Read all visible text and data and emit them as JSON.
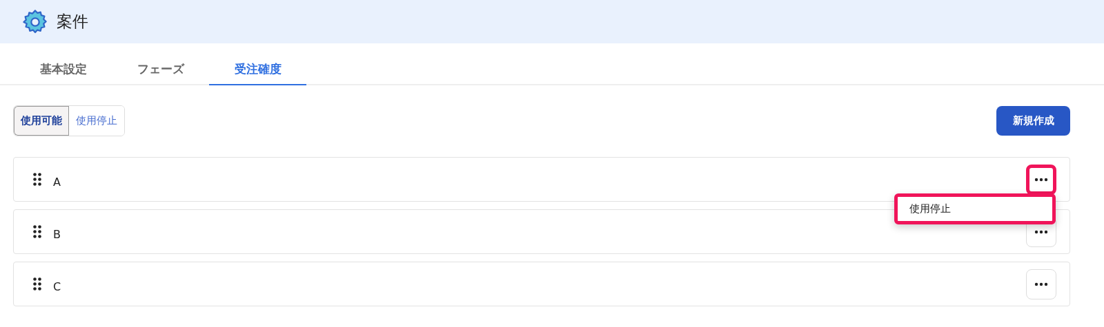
{
  "header": {
    "title": "案件"
  },
  "tabs": [
    {
      "label": "基本設定",
      "selected": false
    },
    {
      "label": "フェーズ",
      "selected": false
    },
    {
      "label": "受注確度",
      "selected": true
    }
  ],
  "filter": [
    {
      "label": "使用可能",
      "selected": true
    },
    {
      "label": "使用停止",
      "selected": false
    }
  ],
  "new_button": "新規作成",
  "rows": [
    {
      "name": "A",
      "menu_open": true,
      "highlighted": true
    },
    {
      "name": "B",
      "menu_open": false,
      "highlighted": false
    },
    {
      "name": "C",
      "menu_open": false,
      "highlighted": false
    }
  ],
  "menu": {
    "items": [
      "使用停止"
    ],
    "highlighted": true
  }
}
